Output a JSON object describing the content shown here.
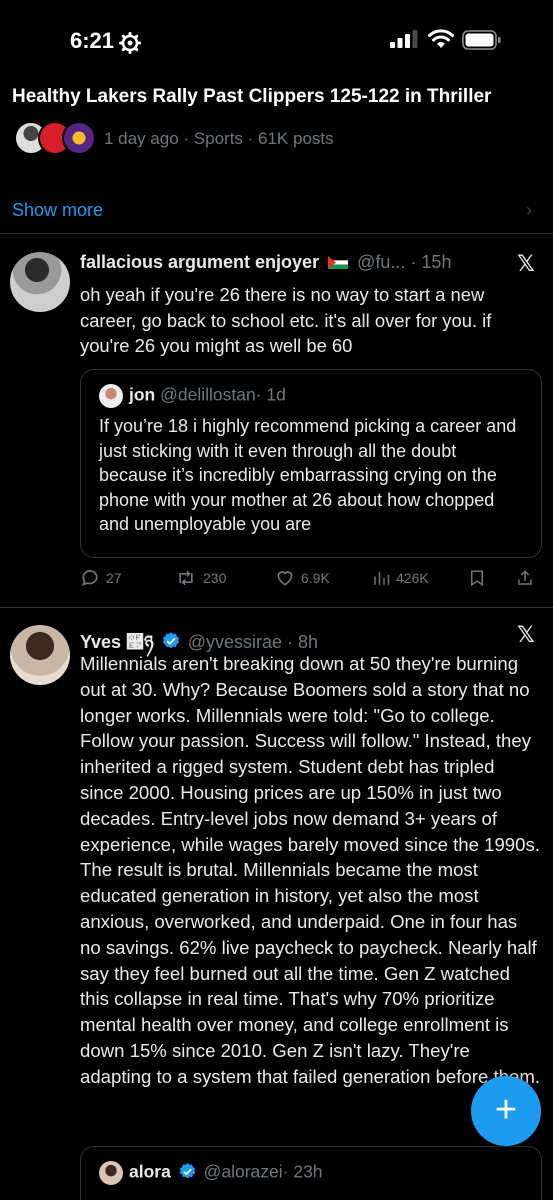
{
  "status_bar": {
    "time": "6:21"
  },
  "trend": {
    "title": "Healthy Lakers Rally Past Clippers 125-122 in Thriller",
    "meta": "1 day ago · Sports · 61K posts",
    "show_more": "Show more"
  },
  "tweet1": {
    "name": "fallacious argument enjoyer",
    "handle": "@fu...",
    "time": "· 15h",
    "text": "oh yeah if you're 26 there is no way to start a new career, go back to school etc. it's all over for you. if you're 26 you might as well be 60",
    "quote": {
      "name": "jon",
      "handle": "@delillostan",
      "time": "· 1d",
      "text": "If you’re 18 i highly recommend picking a career and just sticking with it even through all the doubt because it’s incredibly embarrassing crying on the phone with your mother at 26 about how chopped and unemployable you are"
    },
    "replies": "27",
    "reposts": "230",
    "likes": "6.9K",
    "views": "426K"
  },
  "tweet2": {
    "name": "Yves ࿧ཉ",
    "handle": "@yvessirae",
    "time": "· 8h",
    "text": "Millennials aren't breaking down at 50 they're burning out at 30. Why? Because Boomers sold a story that no longer works. Millennials were told: \"Go to college. Follow your passion. Success will follow.\" Instead, they inherited a rigged system. Student debt has tripled since 2000. Housing prices are up 150% in just two decades. Entry-level jobs now demand 3+ years of experience, while wages barely moved since the 1990s. The result is brutal. Millennials became the most educated generation in history, yet also the most anxious, overworked, and underpaid. One in four has no savings. 62% live paycheck to paycheck. Nearly half say they feel burned out all the time. Gen Z watched this collapse in real time. That's why 70% prioritize mental health over money, and college enrollment is down 15% since 2010. Gen Z isn't lazy. They're adapting to a system that failed generation before them.",
    "quote": {
      "name": "alora",
      "handle": "@alorazei",
      "time": "· 23h"
    }
  },
  "colors": {
    "accent": "#1d9bf0",
    "muted": "#71767b",
    "text": "#e7e9ea",
    "border": "#2f3336"
  }
}
